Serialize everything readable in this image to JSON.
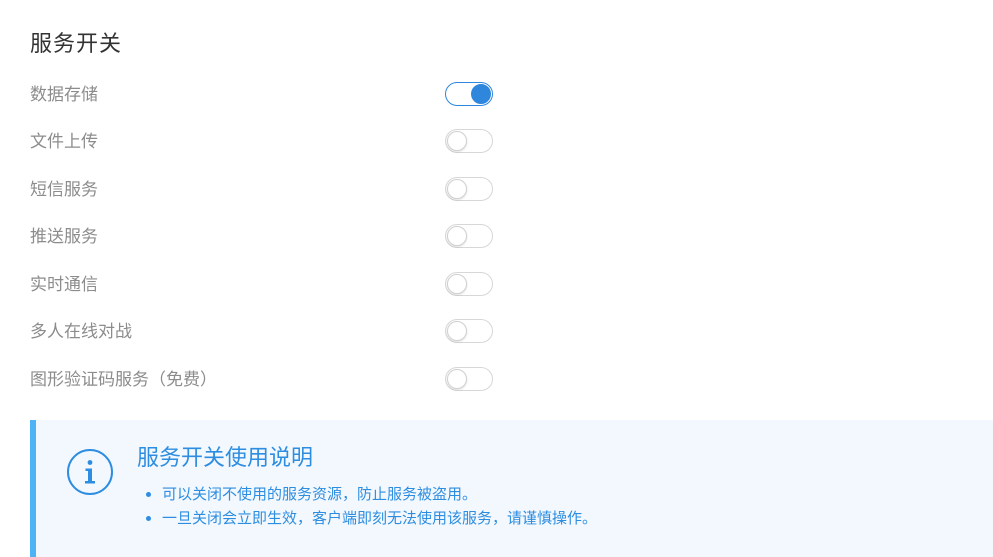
{
  "section": {
    "title": "服务开关"
  },
  "switches": [
    {
      "label": "数据存储",
      "on": true
    },
    {
      "label": "文件上传",
      "on": false
    },
    {
      "label": "短信服务",
      "on": false
    },
    {
      "label": "推送服务",
      "on": false
    },
    {
      "label": "实时通信",
      "on": false
    },
    {
      "label": "多人在线对战",
      "on": false
    },
    {
      "label": "图形验证码服务（免费）",
      "on": false
    }
  ],
  "info": {
    "icon": "info-circle-icon",
    "title": "服务开关使用说明",
    "items": [
      "可以关闭不使用的服务资源，防止服务被盗用。",
      "一旦关闭会立即生效，客户端即刻无法使用该服务，请谨慎操作。"
    ]
  },
  "colors": {
    "accent": "#2f86dd",
    "info_border": "#4db3f4",
    "info_bg": "#f3f8fe",
    "label": "#8c8c8c",
    "title": "#333333"
  }
}
